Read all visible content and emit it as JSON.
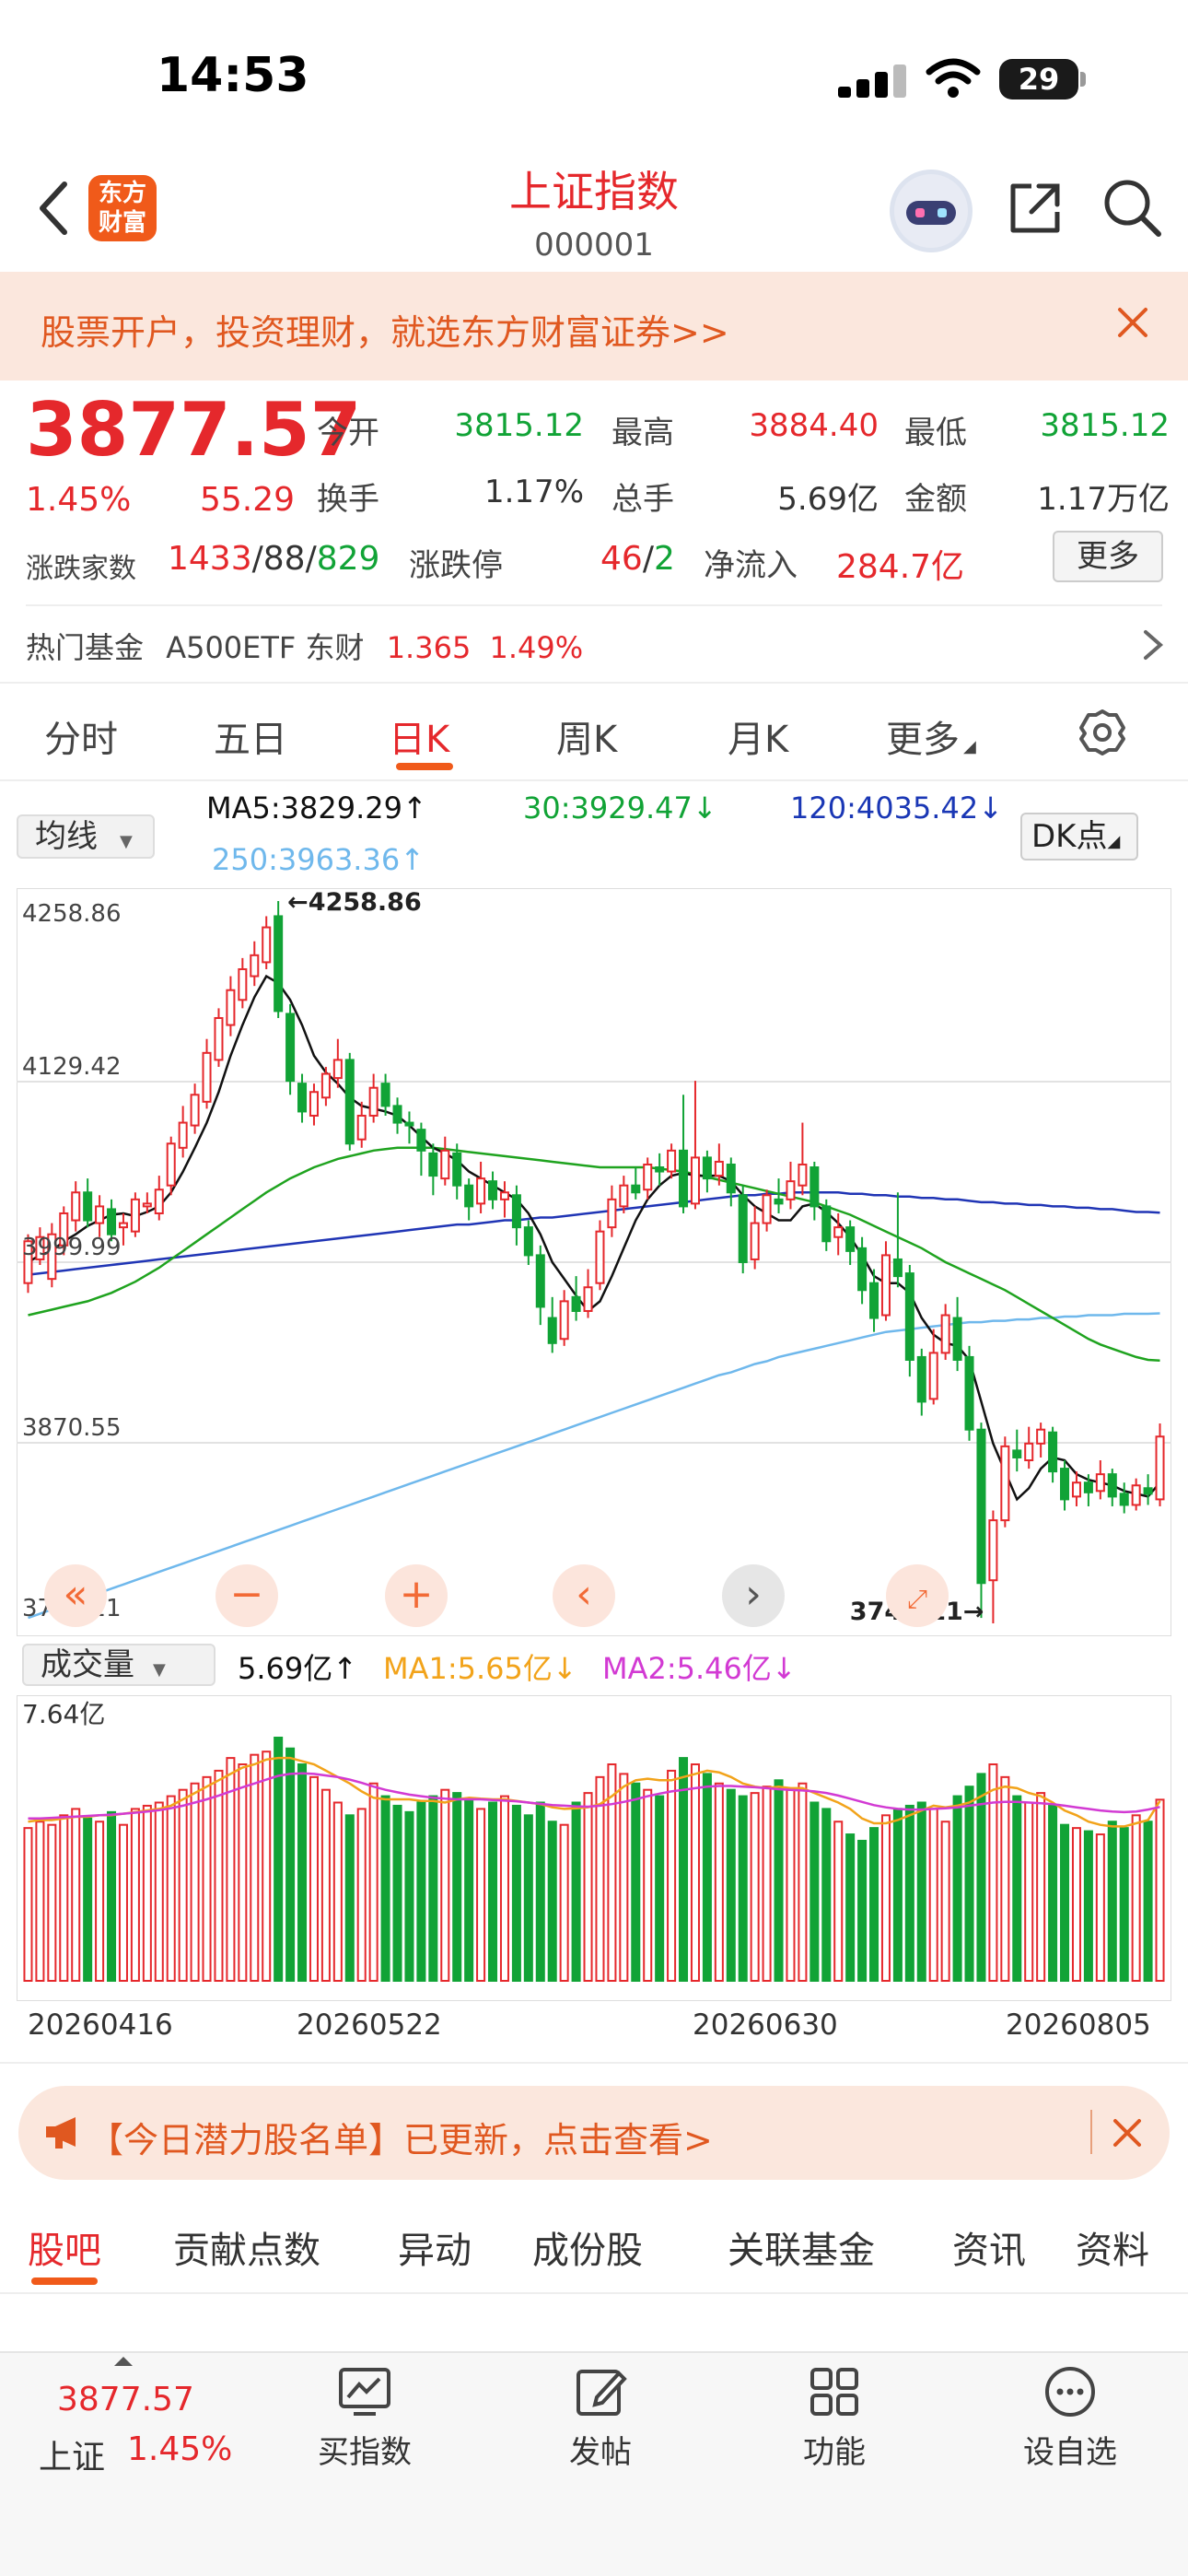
{
  "status": {
    "time": "14:53",
    "battery": "29"
  },
  "header": {
    "title": "上证指数",
    "code": "000001",
    "logo": "东方财富"
  },
  "promo": {
    "text": "股票开户，投资理财，就选东方财富证券>>"
  },
  "quote": {
    "price": "3877.57",
    "pct": "1.45%",
    "chg": "55.29",
    "open_label": "今开",
    "open": "3815.12",
    "high_label": "最高",
    "high": "3884.40",
    "low_label": "最低",
    "low": "3815.12",
    "turnover_label": "换手",
    "turnover": "1.17%",
    "volume_label": "总手",
    "volume": "5.69亿",
    "amount_label": "金额",
    "amount": "1.17万亿",
    "breadth_label": "涨跌家数",
    "up": "1433",
    "flat": "88",
    "down": "829",
    "limit_label": "涨跌停",
    "limit_up": "46",
    "limit_down": "2",
    "inflow_label": "净流入",
    "inflow": "284.7亿",
    "more": "更多"
  },
  "fund": {
    "label": "热门基金",
    "name": "A500ETF 东财",
    "price": "1.365",
    "pct": "1.49%"
  },
  "tabs": [
    "分时",
    "五日",
    "日K",
    "周K",
    "月K",
    "更多"
  ],
  "ma": {
    "select": "均线",
    "ma5": "MA5:3829.29↑",
    "ma30": "30:3929.47↓",
    "ma120": "120:4035.42↓",
    "ma250": "250:3963.36↑",
    "dk": "DK点"
  },
  "volume_panel": {
    "select": "成交量",
    "value": "5.69亿↑",
    "ma1": "MA1:5.65亿↓",
    "ma2": "MA2:5.46亿↓",
    "max": "7.64亿"
  },
  "colors": {
    "up": "#e5282c",
    "down": "#11a336",
    "ma5": "#111111",
    "ma30": "#1fa31f",
    "ma120": "#2035b5",
    "ma250": "#6fb8ec",
    "vma1": "#f2a31a",
    "vma2": "#d23ad3"
  },
  "chart_data": {
    "type": "candlestick",
    "y_ticks": [
      "4258.86",
      "4129.42",
      "3999.99",
      "3870.55",
      "3741.11"
    ],
    "ylim": [
      3741.11,
      4258.86
    ],
    "high_label": "4258.86",
    "low_label": "3741.11",
    "x_labels": [
      "20260416",
      "20260522",
      "20260630",
      "20260805"
    ],
    "candles": [
      [
        3985,
        4015,
        3978,
        4020
      ],
      [
        4002,
        4018,
        3998,
        4025
      ],
      [
        3988,
        4020,
        3982,
        4028
      ],
      [
        4012,
        4035,
        4005,
        4040
      ],
      [
        4030,
        4050,
        4022,
        4058
      ],
      [
        4050,
        4030,
        4025,
        4060
      ],
      [
        4028,
        4040,
        4018,
        4048
      ],
      [
        4038,
        4020,
        4015,
        4045
      ],
      [
        4025,
        4028,
        4012,
        4035
      ],
      [
        4022,
        4045,
        4018,
        4050
      ],
      [
        4040,
        4042,
        4035,
        4050
      ],
      [
        4035,
        4052,
        4030,
        4062
      ],
      [
        4055,
        4085,
        4048,
        4090
      ],
      [
        4082,
        4100,
        4075,
        4112
      ],
      [
        4098,
        4120,
        4092,
        4128
      ],
      [
        4115,
        4150,
        4110,
        4160
      ],
      [
        4145,
        4175,
        4140,
        4182
      ],
      [
        4170,
        4195,
        4162,
        4205
      ],
      [
        4188,
        4210,
        4182,
        4218
      ],
      [
        4205,
        4220,
        4198,
        4230
      ],
      [
        4215,
        4240,
        4210,
        4248
      ],
      [
        4248,
        4180,
        4175,
        4258.86
      ],
      [
        4178,
        4130,
        4120,
        4185
      ],
      [
        4128,
        4108,
        4100,
        4135
      ],
      [
        4105,
        4122,
        4098,
        4128
      ],
      [
        4118,
        4135,
        4112,
        4140
      ],
      [
        4132,
        4145,
        4125,
        4160
      ],
      [
        4145,
        4085,
        4080,
        4150
      ],
      [
        4088,
        4105,
        4082,
        4115
      ],
      [
        4105,
        4125,
        4100,
        4135
      ],
      [
        4128,
        4112,
        4105,
        4135
      ],
      [
        4112,
        4100,
        4092,
        4118
      ],
      [
        4100,
        4098,
        4085,
        4108
      ],
      [
        4095,
        4080,
        4062,
        4100
      ],
      [
        4078,
        4062,
        4048,
        4085
      ],
      [
        4060,
        4080,
        4055,
        4090
      ],
      [
        4078,
        4055,
        4045,
        4085
      ],
      [
        4055,
        4040,
        4030,
        4060
      ],
      [
        4042,
        4060,
        4035,
        4072
      ],
      [
        4058,
        4045,
        4038,
        4065
      ],
      [
        4045,
        4050,
        4032,
        4058
      ],
      [
        4048,
        4025,
        4012,
        4055
      ],
      [
        4025,
        4005,
        3998,
        4030
      ],
      [
        4005,
        3968,
        3955,
        4012
      ],
      [
        3960,
        3942,
        3935,
        3975
      ],
      [
        3945,
        3972,
        3940,
        3980
      ],
      [
        3975,
        3965,
        3958,
        3990
      ],
      [
        3965,
        3982,
        3960,
        3995
      ],
      [
        3985,
        4022,
        3980,
        4030
      ],
      [
        4025,
        4045,
        4018,
        4055
      ],
      [
        4040,
        4055,
        4035,
        4062
      ],
      [
        4055,
        4050,
        4045,
        4068
      ],
      [
        4052,
        4070,
        4045,
        4075
      ],
      [
        4068,
        4065,
        4055,
        4078
      ],
      [
        4065,
        4080,
        4060,
        4085
      ],
      [
        4080,
        4040,
        4035,
        4120
      ],
      [
        4042,
        4075,
        4038,
        4130
      ],
      [
        4075,
        4060,
        4050,
        4080
      ],
      [
        4062,
        4072,
        4055,
        4085
      ],
      [
        4070,
        4050,
        4040,
        4075
      ],
      [
        4048,
        4000,
        3992,
        4055
      ],
      [
        4002,
        4028,
        3995,
        4040
      ],
      [
        4028,
        4048,
        4022,
        4052
      ],
      [
        4045,
        4042,
        4035,
        4060
      ],
      [
        4045,
        4058,
        4038,
        4072
      ],
      [
        4055,
        4070,
        4048,
        4100
      ],
      [
        4068,
        4040,
        4030,
        4072
      ],
      [
        4040,
        4015,
        4008,
        4045
      ],
      [
        4018,
        4025,
        4005,
        4035
      ],
      [
        4025,
        4008,
        3998,
        4030
      ],
      [
        4010,
        3980,
        3970,
        4018
      ],
      [
        3985,
        3960,
        3950,
        3995
      ],
      [
        3962,
        4005,
        3958,
        4015
      ],
      [
        4002,
        3990,
        3982,
        4050
      ],
      [
        3992,
        3930,
        3918,
        3998
      ],
      [
        3932,
        3900,
        3890,
        3938
      ],
      [
        3902,
        3935,
        3898,
        3952
      ],
      [
        3935,
        3962,
        3930,
        3970
      ],
      [
        3960,
        3930,
        3922,
        3975
      ],
      [
        3932,
        3880,
        3872,
        3940
      ],
      [
        3880,
        3770,
        3745,
        3885
      ],
      [
        3772,
        3815,
        3741.11,
        3822
      ],
      [
        3815,
        3868,
        3810,
        3875
      ],
      [
        3865,
        3860,
        3850,
        3880
      ],
      [
        3858,
        3870,
        3852,
        3882
      ],
      [
        3870,
        3880,
        3860,
        3885
      ],
      [
        3878,
        3850,
        3842,
        3882
      ],
      [
        3852,
        3830,
        3822,
        3858
      ],
      [
        3832,
        3842,
        3825,
        3850
      ],
      [
        3842,
        3835,
        3825,
        3848
      ],
      [
        3836,
        3848,
        3830,
        3858
      ],
      [
        3848,
        3832,
        3825,
        3852
      ],
      [
        3834,
        3826,
        3820,
        3842
      ],
      [
        3826,
        3840,
        3822,
        3845
      ],
      [
        3838,
        3834,
        3826,
        3848
      ],
      [
        3830,
        3875,
        3825,
        3884.4
      ]
    ],
    "ma5": [
      4000,
      4005,
      4008,
      4015,
      4020,
      4026,
      4030,
      4034,
      4035,
      4033,
      4036,
      4040,
      4050,
      4065,
      4082,
      4100,
      4122,
      4148,
      4170,
      4190,
      4205,
      4200,
      4188,
      4170,
      4148,
      4136,
      4128,
      4118,
      4112,
      4110,
      4108,
      4105,
      4098,
      4090,
      4082,
      4078,
      4073,
      4065,
      4060,
      4055,
      4050,
      4045,
      4035,
      4020,
      4000,
      3988,
      3976,
      3965,
      3972,
      3990,
      4010,
      4030,
      4045,
      4055,
      4062,
      4064,
      4062,
      4062,
      4062,
      4058,
      4048,
      4040,
      4035,
      4030,
      4030,
      4040,
      4042,
      4036,
      4028,
      4018,
      4005,
      3990,
      3985,
      3985,
      3978,
      3960,
      3948,
      3942,
      3940,
      3930,
      3900,
      3870,
      3850,
      3830,
      3838,
      3852,
      3860,
      3858,
      3848,
      3844,
      3842,
      3840,
      3836,
      3834,
      3832,
      3842
    ],
    "ma30": [
      3962,
      3964,
      3966,
      3968,
      3970,
      3972,
      3975,
      3978,
      3982,
      3986,
      3991,
      3996,
      4002,
      4008,
      4014,
      4020,
      4026,
      4032,
      4038,
      4044,
      4050,
      4055,
      4060,
      4064,
      4068,
      4071,
      4074,
      4076,
      4078,
      4080,
      4081,
      4082,
      4082,
      4082,
      4082,
      4081,
      4080,
      4079,
      4078,
      4077,
      4076,
      4075,
      4074,
      4073,
      4072,
      4071,
      4070,
      4069,
      4068,
      4068,
      4068,
      4068,
      4068,
      4067,
      4066,
      4065,
      4063,
      4061,
      4059,
      4057,
      4055,
      4053,
      4051,
      4049,
      4047,
      4045,
      4043,
      4040,
      4037,
      4034,
      4030,
      4026,
      4022,
      4018,
      4014,
      4010,
      4005,
      4000,
      3996,
      3992,
      3988,
      3984,
      3980,
      3975,
      3970,
      3965,
      3960,
      3955,
      3950,
      3945,
      3941,
      3938,
      3935,
      3932,
      3930,
      3929.47
    ],
    "ma120": [
      3991,
      3992,
      3993,
      3994,
      3995,
      3996,
      3997,
      3998,
      3999,
      4000,
      4001,
      4002,
      4003,
      4004,
      4005,
      4006,
      4007,
      4008,
      4009,
      4010,
      4011,
      4012,
      4013,
      4014,
      4015,
      4016,
      4017,
      4018,
      4019,
      4020,
      4021,
      4022,
      4023,
      4024,
      4025,
      4026,
      4027,
      4027,
      4028,
      4029,
      4030,
      4030,
      4031,
      4032,
      4032,
      4033,
      4034,
      4035,
      4036,
      4037,
      4038,
      4039,
      4040,
      4041,
      4042,
      4043,
      4044,
      4045,
      4046,
      4047,
      4048,
      4048,
      4049,
      4049,
      4050,
      4050,
      4050,
      4050,
      4050,
      4049,
      4049,
      4048,
      4048,
      4047,
      4047,
      4046,
      4046,
      4045,
      4045,
      4044,
      4043,
      4043,
      4042,
      4042,
      4041,
      4041,
      4040,
      4040,
      4039,
      4039,
      4038,
      4038,
      4037,
      4036,
      4036,
      4035.42
    ],
    "ma250": [
      3745,
      3748,
      3751,
      3754,
      3757,
      3760,
      3763,
      3766,
      3769,
      3772,
      3775,
      3778,
      3781,
      3784,
      3787,
      3790,
      3793,
      3796,
      3799,
      3802,
      3805,
      3808,
      3811,
      3814,
      3817,
      3820,
      3823,
      3826,
      3829,
      3832,
      3835,
      3838,
      3841,
      3844,
      3847,
      3850,
      3853,
      3856,
      3859,
      3862,
      3865,
      3868,
      3871,
      3874,
      3877,
      3880,
      3883,
      3886,
      3889,
      3892,
      3895,
      3898,
      3901,
      3904,
      3907,
      3910,
      3913,
      3916,
      3919,
      3921,
      3924,
      3927,
      3929,
      3932,
      3934,
      3936,
      3938,
      3940,
      3942,
      3944,
      3946,
      3948,
      3950,
      3951,
      3952,
      3953,
      3954,
      3955,
      3956,
      3957,
      3957,
      3958,
      3958,
      3959,
      3959,
      3960,
      3960,
      3961,
      3961,
      3962,
      3962,
      3962,
      3963,
      3963,
      3963,
      3963.36
    ],
    "volume": [
      4.8,
      5.0,
      4.9,
      5.2,
      5.4,
      5.1,
      5.0,
      5.3,
      4.9,
      5.4,
      5.5,
      5.6,
      5.8,
      6.0,
      6.2,
      6.4,
      6.6,
      7.0,
      6.8,
      7.1,
      7.2,
      7.64,
      7.3,
      6.8,
      6.4,
      6.0,
      5.6,
      5.2,
      5.4,
      6.2,
      5.8,
      5.5,
      5.3,
      5.6,
      5.8,
      6.0,
      5.9,
      5.7,
      5.4,
      5.6,
      5.8,
      5.5,
      5.2,
      5.6,
      5.0,
      4.9,
      5.6,
      5.9,
      6.4,
      6.8,
      6.5,
      6.2,
      6.0,
      5.8,
      6.6,
      7.0,
      6.8,
      6.5,
      6.2,
      6.0,
      5.8,
      5.9,
      6.1,
      6.3,
      6.0,
      6.2,
      5.6,
      5.4,
      5.0,
      4.6,
      4.4,
      4.8,
      5.2,
      5.4,
      5.5,
      5.6,
      5.4,
      5.0,
      5.8,
      6.1,
      6.5,
      6.8,
      6.4,
      5.8,
      5.6,
      5.9,
      5.5,
      4.9,
      4.8,
      4.7,
      4.6,
      5.0,
      4.8,
      5.2,
      5.0,
      5.69
    ],
    "vol_ma1": [
      5.0,
      5.05,
      5.05,
      5.1,
      5.15,
      5.15,
      5.2,
      5.2,
      5.25,
      5.3,
      5.35,
      5.4,
      5.5,
      5.7,
      5.9,
      6.1,
      6.3,
      6.5,
      6.7,
      6.8,
      6.95,
      7.0,
      7.0,
      6.9,
      6.8,
      6.6,
      6.4,
      6.2,
      5.95,
      5.75,
      5.7,
      5.7,
      5.7,
      5.65,
      5.65,
      5.6,
      5.7,
      5.75,
      5.72,
      5.7,
      5.7,
      5.65,
      5.6,
      5.55,
      5.45,
      5.4,
      5.42,
      5.45,
      5.55,
      5.8,
      6.1,
      6.3,
      6.35,
      6.3,
      6.3,
      6.4,
      6.5,
      6.6,
      6.55,
      6.4,
      6.2,
      6.1,
      6.05,
      6.1,
      6.05,
      6.05,
      5.9,
      5.75,
      5.6,
      5.4,
      5.1,
      4.95,
      4.95,
      5.05,
      5.2,
      5.35,
      5.5,
      5.45,
      5.5,
      5.6,
      5.8,
      6.0,
      6.1,
      6.05,
      5.9,
      5.8,
      5.6,
      5.35,
      5.2,
      5.0,
      4.9,
      4.85,
      4.85,
      4.95,
      5.05,
      5.65
    ],
    "vol_ma2": [
      5.1,
      5.1,
      5.12,
      5.14,
      5.16,
      5.18,
      5.2,
      5.22,
      5.25,
      5.28,
      5.32,
      5.36,
      5.42,
      5.5,
      5.6,
      5.7,
      5.82,
      5.95,
      6.08,
      6.2,
      6.32,
      6.44,
      6.5,
      6.52,
      6.5,
      6.45,
      6.4,
      6.32,
      6.22,
      6.1,
      6.0,
      5.92,
      5.85,
      5.8,
      5.75,
      5.72,
      5.7,
      5.7,
      5.7,
      5.68,
      5.66,
      5.64,
      5.6,
      5.56,
      5.52,
      5.5,
      5.48,
      5.47,
      5.5,
      5.55,
      5.62,
      5.7,
      5.8,
      5.88,
      5.95,
      6.0,
      6.05,
      6.1,
      6.12,
      6.12,
      6.1,
      6.08,
      6.05,
      6.02,
      6.0,
      5.98,
      5.95,
      5.9,
      5.82,
      5.72,
      5.62,
      5.52,
      5.45,
      5.4,
      5.38,
      5.38,
      5.4,
      5.42,
      5.45,
      5.5,
      5.55,
      5.6,
      5.62,
      5.62,
      5.6,
      5.58,
      5.55,
      5.5,
      5.45,
      5.4,
      5.35,
      5.32,
      5.3,
      5.32,
      5.38,
      5.46
    ]
  },
  "notice": {
    "text": "【今日潜力股名单】已更新，点击查看>"
  },
  "bottom_tabs": [
    "股吧",
    "贡献点数",
    "异动",
    "成份股",
    "关联基金",
    "资讯",
    "资料"
  ],
  "toolbar": {
    "index_price": "3877.57",
    "index_name": "上证",
    "index_pct": "1.45%",
    "buy": "买指数",
    "post": "发帖",
    "func": "功能",
    "watch": "设自选"
  }
}
